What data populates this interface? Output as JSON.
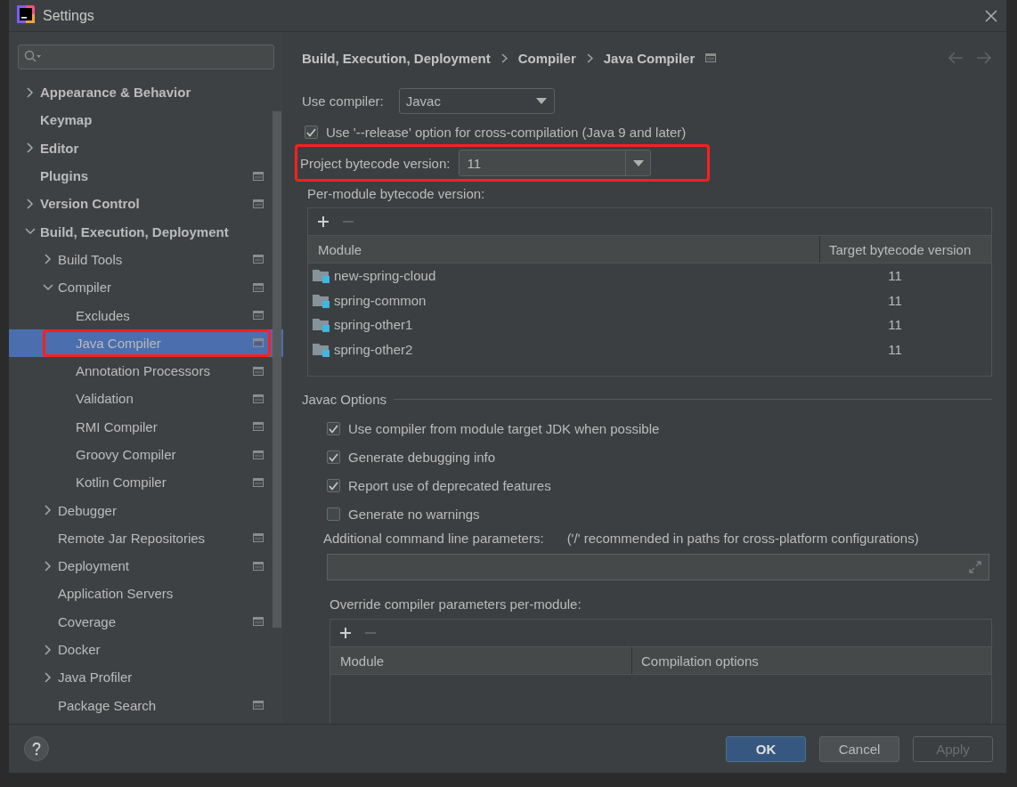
{
  "window": {
    "title": "Settings"
  },
  "tree": [
    {
      "label": "Appearance & Behavior",
      "expanded": false,
      "project_scope": false,
      "selected": false,
      "highlighted": false
    },
    {
      "label": "Keymap",
      "project_scope": false,
      "selected": false,
      "highlighted": false
    },
    {
      "label": "Editor",
      "expanded": false,
      "project_scope": false,
      "selected": false,
      "highlighted": false
    },
    {
      "label": "Plugins",
      "project_scope": true,
      "selected": false,
      "highlighted": false
    },
    {
      "label": "Version Control",
      "expanded": false,
      "project_scope": true,
      "selected": false,
      "highlighted": false
    },
    {
      "label": "Build, Execution, Deployment",
      "expanded": true,
      "project_scope": false,
      "selected": false,
      "highlighted": false,
      "children": [
        {
          "label": "Build Tools",
          "expanded": false,
          "project_scope": true,
          "selected": false,
          "highlighted": false
        },
        {
          "label": "Compiler",
          "expanded": true,
          "project_scope": true,
          "selected": false,
          "highlighted": false,
          "children": [
            {
              "label": "Excludes",
              "project_scope": true,
              "selected": false,
              "highlighted": false
            },
            {
              "label": "Java Compiler",
              "project_scope": true,
              "selected": true,
              "highlighted": true
            },
            {
              "label": "Annotation Processors",
              "project_scope": true,
              "selected": false,
              "highlighted": false
            },
            {
              "label": "Validation",
              "project_scope": true,
              "selected": false,
              "highlighted": false
            },
            {
              "label": "RMI Compiler",
              "project_scope": true,
              "selected": false,
              "highlighted": false
            },
            {
              "label": "Groovy Compiler",
              "project_scope": true,
              "selected": false,
              "highlighted": false
            },
            {
              "label": "Kotlin Compiler",
              "project_scope": true,
              "selected": false,
              "highlighted": false
            }
          ]
        },
        {
          "label": "Debugger",
          "expanded": false,
          "project_scope": false,
          "selected": false,
          "highlighted": false
        },
        {
          "label": "Remote Jar Repositories",
          "project_scope": true,
          "selected": false,
          "highlighted": false
        },
        {
          "label": "Deployment",
          "expanded": false,
          "project_scope": true,
          "selected": false,
          "highlighted": false
        },
        {
          "label": "Application Servers",
          "project_scope": false,
          "selected": false,
          "highlighted": false
        },
        {
          "label": "Coverage",
          "project_scope": true,
          "selected": false,
          "highlighted": false
        },
        {
          "label": "Docker",
          "expanded": false,
          "project_scope": false,
          "selected": false,
          "highlighted": false
        },
        {
          "label": "Java Profiler",
          "expanded": false,
          "project_scope": false,
          "selected": false,
          "highlighted": false
        },
        {
          "label": "Package Search",
          "project_scope": true,
          "selected": false,
          "highlighted": false
        }
      ]
    }
  ],
  "breadcrumb": [
    "Build, Execution, Deployment",
    "Compiler",
    "Java Compiler"
  ],
  "use_compiler": {
    "label": "Use compiler:",
    "value": "Javac"
  },
  "release_option": {
    "label": "Use '--release' option for cross-compilation (Java 9 and later)",
    "checked": true
  },
  "project_bytecode": {
    "label": "Project bytecode version:",
    "value": "11",
    "highlighted": true
  },
  "per_module": {
    "label": "Per-module bytecode version:",
    "columns": [
      "Module",
      "Target bytecode version"
    ],
    "rows": [
      {
        "module": "new-spring-cloud",
        "version": "11"
      },
      {
        "module": "spring-common",
        "version": "11"
      },
      {
        "module": "spring-other1",
        "version": "11"
      },
      {
        "module": "spring-other2",
        "version": "11"
      }
    ]
  },
  "javac_options": {
    "title": "Javac Options",
    "options": [
      {
        "label": "Use compiler from module target JDK when possible",
        "checked": true
      },
      {
        "label": "Generate debugging info",
        "checked": true
      },
      {
        "label": "Report use of deprecated features",
        "checked": true
      },
      {
        "label": "Generate no warnings",
        "checked": false
      }
    ],
    "additional_parameters": {
      "label": "Additional command line parameters:",
      "hint": "('/' recommended in paths for cross-platform configurations)"
    },
    "override": {
      "label": "Override compiler parameters per-module:",
      "columns": [
        "Module",
        "Compilation options"
      ]
    }
  },
  "buttons": [
    {
      "label": "OK",
      "kind": "primary",
      "disabled": false
    },
    {
      "label": "Cancel",
      "kind": "normal",
      "disabled": false
    },
    {
      "label": "Apply",
      "kind": "normal",
      "disabled": true
    }
  ]
}
